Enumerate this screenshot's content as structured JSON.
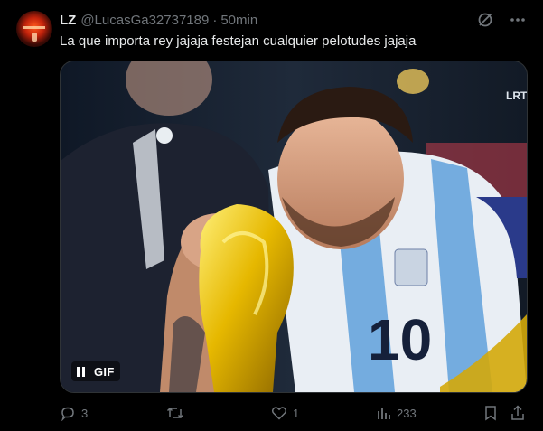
{
  "tweet": {
    "display_name": "LZ",
    "handle": "@LucasGa32737189",
    "separator": "·",
    "time": "50min",
    "text": "La que importa rey jajaja festejan cualquier pelotudes jajaja"
  },
  "media": {
    "gif_label": "GIF",
    "jersey_number": "10",
    "broadcaster_logo": "LRT"
  },
  "actions": {
    "replies": "3",
    "retweets": "",
    "likes": "1",
    "views": "233"
  },
  "colors": {
    "background": "#000000",
    "text_primary": "#e7e9ea",
    "text_secondary": "#71767b",
    "border": "#2f3336"
  }
}
